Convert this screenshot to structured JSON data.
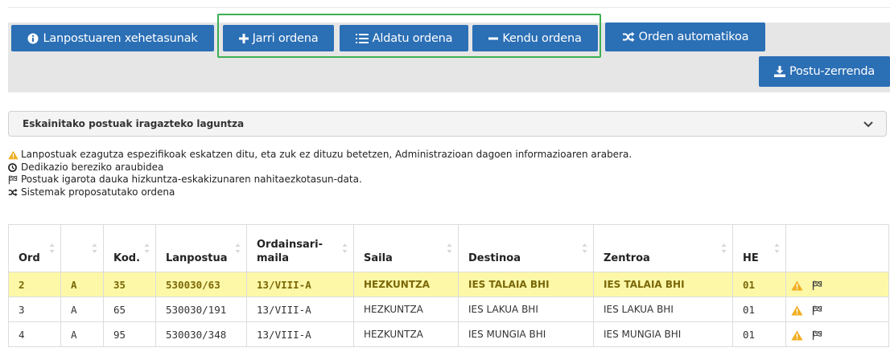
{
  "toolbar": {
    "details_label": "Lanpostuaren xehetasunak",
    "add_label": "Jarri ordena",
    "modify_label": "Aldatu ordena",
    "remove_label": "Kendu ordena",
    "auto_label": "Orden automatikoa",
    "download_label": "Postu-zerrenda"
  },
  "filter_help": {
    "label": "Eskainitako postuak iragazteko laguntza"
  },
  "legend": [
    {
      "icon": "warning-icon",
      "text": "Lanpostuak ezagutza espezifikoak eskatzen ditu, eta zuk ez dituzu betetzen, Administrazioan dagoen informazioaren arabera."
    },
    {
      "icon": "clock-icon",
      "text": "Dedikazio bereziko araubidea"
    },
    {
      "icon": "flag-icon",
      "text": "Postuak igarota dauka hizkuntza-eskakizunaren nahitaezkotasun-data."
    },
    {
      "icon": "random-icon",
      "text": "Sistemak proposatutako ordena"
    }
  ],
  "table": {
    "headers": {
      "ord": "Ord",
      "type": "",
      "kod": "Kod.",
      "lanpostua": "Lanpostua",
      "ordainsari_1": "Ordainsari-",
      "ordainsari_2": "maila",
      "saila": "Saila",
      "destinoa": "Destinoa",
      "zentroa": "Zentroa",
      "he": "HE",
      "icons": ""
    },
    "rows": [
      {
        "ord": "2",
        "type": "A",
        "kod": "35",
        "lanpostua": "530030/63",
        "ordainsari": "13/VIII-A",
        "saila": "HEZKUNTZA",
        "destinoa": "IES TALAIA BHI",
        "zentroa": "IES TALAIA BHI",
        "he": "01",
        "icons": [
          "warning-icon",
          "flag-icon"
        ]
      },
      {
        "ord": "3",
        "type": "A",
        "kod": "65",
        "lanpostua": "530030/191",
        "ordainsari": "13/VIII-A",
        "saila": "HEZKUNTZA",
        "destinoa": "IES LAKUA BHI",
        "zentroa": "IES LAKUA BHI",
        "he": "01",
        "icons": [
          "warning-icon",
          "flag-icon"
        ]
      },
      {
        "ord": "4",
        "type": "A",
        "kod": "95",
        "lanpostua": "530030/348",
        "ordainsari": "13/VIII-A",
        "saila": "HEZKUNTZA",
        "destinoa": "IES MUNGIA BHI",
        "zentroa": "IES MUNGIA BHI",
        "he": "01",
        "icons": [
          "warning-icon",
          "flag-icon"
        ]
      }
    ]
  },
  "colors": {
    "button": "#2b6fb5",
    "highlight_border": "#3cb054",
    "selected_row": "#fdf8a7",
    "warning": "#f0ad1e"
  }
}
